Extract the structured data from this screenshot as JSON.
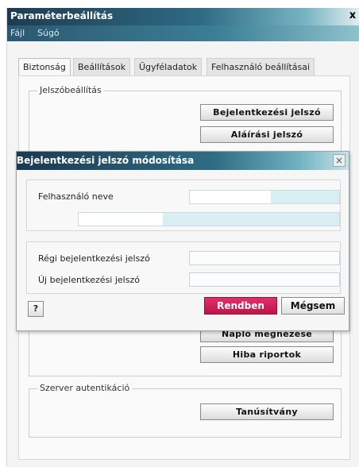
{
  "window": {
    "title": "Paraméterbeállítás",
    "close": "x"
  },
  "menu": [
    "Fájl",
    "Súgó"
  ],
  "tabs": [
    "Biztonság",
    "Beállítások",
    "Ügyféladatok",
    "Felhasználó beállításai"
  ],
  "password_group": {
    "legend": "Jelszóbeállítás",
    "login_password_button": "Bejelentkezési jelszó",
    "signature_password_button": "Aláírási jelszó"
  },
  "log_group": {
    "log_view_button": "Napló megnézése",
    "error_reports_button": "Hiba riportok"
  },
  "server_group": {
    "legend": "Szerver autentikáció",
    "certificate_button": "Tanúsítvány"
  },
  "dialog": {
    "title": "Bejelentkezési jelszó módosítása",
    "close": "×",
    "username_label": "Felhasználó neve",
    "old_password_label": "Régi bejelentkezési jelszó",
    "new_password_label": "Új bejelentkezési jelszó",
    "help_label": "?",
    "ok_label": "Rendben",
    "cancel_label": "Mégsem"
  }
}
